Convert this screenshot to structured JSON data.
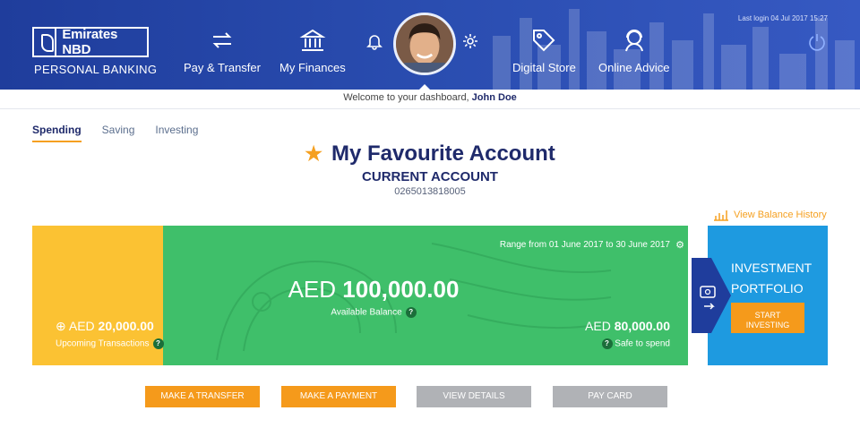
{
  "header": {
    "bank_name": "Emirates NBD",
    "tagline": "PERSONAL BANKING",
    "last_login": "Last login 04 Jul 2017 15:27",
    "nav": [
      {
        "label": "Pay & Transfer",
        "icon": "transfer-arrows-icon"
      },
      {
        "label": "My Finances",
        "icon": "bank-building-icon"
      },
      {
        "label": "Digital Store",
        "icon": "price-tag-icon"
      },
      {
        "label": "Online Advice",
        "icon": "advisor-headset-icon"
      }
    ],
    "colors": {
      "primary": "#2a4db0",
      "accent": "#f5a020"
    }
  },
  "welcome": {
    "prefix": "Welcome to your dashboard, ",
    "name": "John Doe"
  },
  "tabs": [
    "Spending",
    "Saving",
    "Investing"
  ],
  "account": {
    "title": "My Favourite Account",
    "type": "CURRENT ACCOUNT",
    "number": "0265013818005",
    "history_link": "View Balance History"
  },
  "balance_card": {
    "range": "Range from 01 June 2017 to 30 June 2017",
    "currency": "AED",
    "available_balance": "100,000.00",
    "available_label": "Available Balance",
    "upcoming_amount": "20,000.00",
    "upcoming_label": "Upcoming Transactions",
    "safe_amount": "80,000.00",
    "safe_label": "Safe to spend",
    "colors": {
      "yellow": "#fbc233",
      "green": "#3fbf6a",
      "blue": "#1e9ae0"
    }
  },
  "investment": {
    "title_line1": "INVESTMENT",
    "title_line2": "PORTFOLIO",
    "button_line1": "START",
    "button_line2": "INVESTING"
  },
  "actions": {
    "make_transfer": "MAKE A TRANSFER",
    "make_payment": "MAKE A PAYMENT",
    "view_details": "VIEW DETAILS",
    "pay_card": "PAY CARD"
  }
}
